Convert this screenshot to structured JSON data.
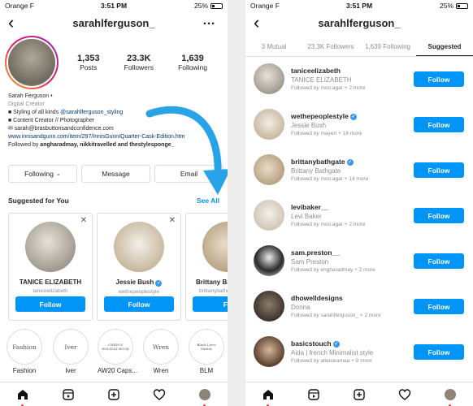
{
  "status": {
    "carrier": "Orange F",
    "time": "3:51 PM",
    "battery": "25%"
  },
  "profile": {
    "username": "sarahlferguson_",
    "more": "…",
    "stats": [
      {
        "num": "1,353",
        "label": "Posts"
      },
      {
        "num": "23.3K",
        "label": "Followers"
      },
      {
        "num": "1,639",
        "label": "Following"
      }
    ],
    "bio": {
      "name": "Sarah Ferguson",
      "category": "Digital Creator",
      "line1_prefix": "■ Styling of all kinds ",
      "line1_mention": "@sarahlferguson_styling",
      "line2": "■ Content Creator // Photographer",
      "line3": "✉ sarah@brasbuttonsandconfidence.com",
      "link": "www.innisandgunn.com/item/297/InnisGunnIQuarter-Cask-Edition.htm",
      "followed_by_prefix": "Followed by ",
      "followed_by": "angharadmay, nikkitravelled and thestylesponge_"
    },
    "buttons": {
      "following": "Following",
      "message": "Message",
      "email": "Email"
    },
    "suggested_title": "Suggested for You",
    "see_all": "See All",
    "cards": [
      {
        "name": "TANICE ELIZABETH",
        "handle": "taniceelizabeth",
        "follow": "Follow"
      },
      {
        "name": "Jessie Bush",
        "handle": "wethepeoplestyle",
        "follow": "Follow"
      },
      {
        "name": "Brittany Ba",
        "handle": "brittanybathga",
        "follow": "Fo"
      }
    ],
    "highlights": [
      {
        "inner": "Fashion",
        "caption": "Fashion"
      },
      {
        "inner": "Iver",
        "caption": "Iver"
      },
      {
        "inner": "CHRIS'S HOLIDAY BOOK",
        "caption": "AW20 Caps..."
      },
      {
        "inner": "Wren",
        "caption": "Wren"
      },
      {
        "inner": "Black Lives Matter",
        "caption": "BLM"
      }
    ]
  },
  "suggested_page": {
    "username": "sarahlferguson_",
    "tabs": [
      "3 Mutual",
      "23.3K Followers",
      "1,639 Following",
      "Suggested"
    ],
    "users": [
      {
        "handle": "taniceelizabeth",
        "verified": false,
        "name": "TANICE ELIZABETH",
        "by": "Followed by mon.agar + 2 more",
        "follow": "Follow"
      },
      {
        "handle": "wethepeoplestyle",
        "verified": true,
        "name": "Jessie Bush",
        "by": "Followed by mayert + 16 more",
        "follow": "Follow"
      },
      {
        "handle": "brittanybathgate",
        "verified": true,
        "name": "Brittany Bathgate",
        "by": "Followed by mon.agar + 14 more",
        "follow": "Follow"
      },
      {
        "handle": "levibaker__",
        "verified": false,
        "name": "Levi Baker",
        "by": "Followed by mon.agar + 2 more",
        "follow": "Follow"
      },
      {
        "handle": "sam.preston__",
        "verified": false,
        "name": "Sam Preston",
        "by": "Followed by engharadmay + 2 more",
        "follow": "Follow"
      },
      {
        "handle": "dhowelldesigns",
        "verified": false,
        "name": "Donna",
        "by": "Followed by sarahlferguson_ + 2 more",
        "follow": "Follow"
      },
      {
        "handle": "basicstouch",
        "verified": true,
        "name": "Aida | french Minimalist style",
        "by": "Followed by allanaramaa + 9 more",
        "follow": "Follow"
      }
    ]
  }
}
